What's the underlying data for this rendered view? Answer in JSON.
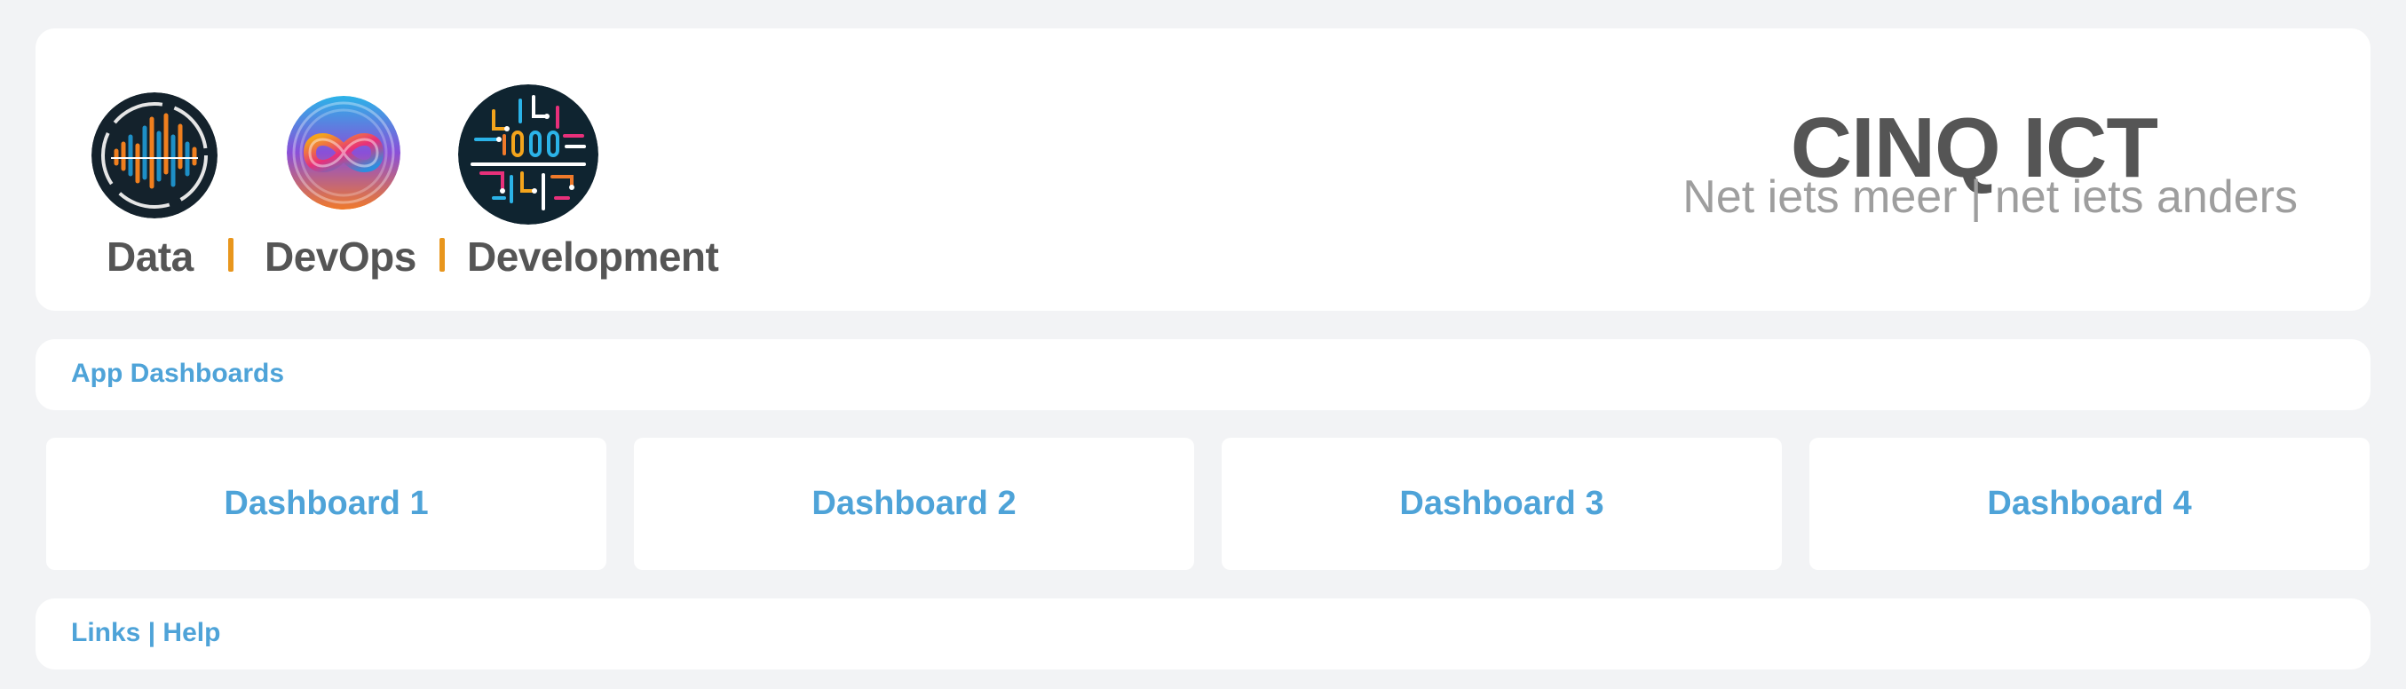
{
  "header": {
    "brands": [
      {
        "label": "Data",
        "icon": "data-waveform-icon"
      },
      {
        "label": "DevOps",
        "icon": "devops-infinity-icon"
      },
      {
        "label": "Development",
        "icon": "development-circuit-icon"
      }
    ],
    "separator": "|",
    "company_name": "CINQ ICT",
    "tagline": "Net iets meer | net iets anders",
    "accent_color": "#e8961d"
  },
  "dashboards_section": {
    "title": "App Dashboards",
    "items": [
      {
        "label": "Dashboard 1"
      },
      {
        "label": "Dashboard 2"
      },
      {
        "label": "Dashboard 3"
      },
      {
        "label": "Dashboard 4"
      }
    ]
  },
  "links_section": {
    "title": "Links | Help"
  },
  "colors": {
    "background": "#f2f3f5",
    "card": "#ffffff",
    "link": "#4ea3d8",
    "text_dark": "#555555",
    "text_muted": "#9e9e9e"
  }
}
